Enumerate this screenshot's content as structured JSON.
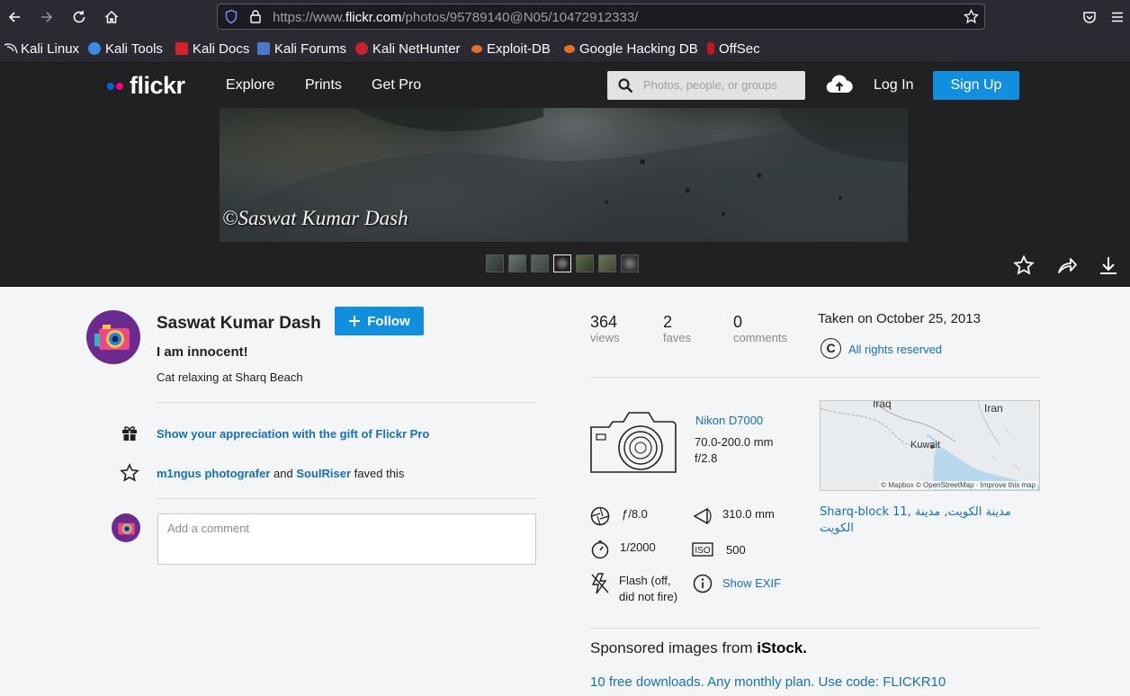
{
  "browser": {
    "url_prefix": "https://www.",
    "url_domain": "flickr.com",
    "url_path": "/photos/95789140@N05/10472912333/",
    "bookmarks": [
      {
        "label": "Kali Linux",
        "icon": "kali-dragon-icon"
      },
      {
        "label": "Kali Tools",
        "icon": "kali-tools-icon"
      },
      {
        "label": "Kali Docs",
        "icon": "kali-docs-icon"
      },
      {
        "label": "Kali Forums",
        "icon": "kali-forums-icon"
      },
      {
        "label": "Kali NetHunter",
        "icon": "nethunter-icon"
      },
      {
        "label": "Exploit-DB",
        "icon": "exploit-db-icon"
      },
      {
        "label": "Google Hacking DB",
        "icon": "ghdb-icon"
      },
      {
        "label": "OffSec",
        "icon": "offsec-icon"
      }
    ]
  },
  "header": {
    "logo_text": "flickr",
    "nav": [
      "Explore",
      "Prints",
      "Get Pro"
    ],
    "search_placeholder": "Photos, people, or groups",
    "login": "Log In",
    "signup": "Sign Up",
    "colors": {
      "brand_blue": "#128fdc",
      "dot_blue": "#0063dc",
      "dot_pink": "#ff0084"
    }
  },
  "photo": {
    "watermark": "©Saswat Kumar Dash"
  },
  "owner": {
    "name": "Saswat Kumar Dash",
    "follow_label": "Follow"
  },
  "details": {
    "title": "I am innocent!",
    "description": "Cat relaxing at Sharq Beach",
    "gift_link": "Show your appreciation with the gift of Flickr Pro",
    "fave_user_1": "m1ngus photografer",
    "fave_and": "and",
    "fave_user_2": "SoulRiser",
    "fave_suffix": "faved this",
    "comment_placeholder": "Add a comment"
  },
  "stats": {
    "views": {
      "value": "364",
      "label": "views"
    },
    "faves": {
      "value": "2",
      "label": "faves"
    },
    "comments": {
      "value": "0",
      "label": "comments"
    }
  },
  "meta": {
    "taken": "Taken on October 25, 2013",
    "rights": "All rights reserved"
  },
  "camera": {
    "name": "Nikon D7000",
    "lens": "70.0-200.0 mm",
    "aperture_max": "f/2.8"
  },
  "exif": {
    "aperture": "ƒ/8.0",
    "focal_length": "310.0 mm",
    "shutter": "1/2000",
    "iso": "500",
    "flash_1": "Flash (off,",
    "flash_2": "did not fire)",
    "show_exif": "Show EXIF"
  },
  "map": {
    "label_iraq": "Iraq",
    "label_iran": "Iran",
    "label_kuwait": "Kuwait",
    "attribution": "© Mapbox © OpenStreetMap · Improve this map"
  },
  "location": "Sharq-block 11, مدينة الكويت, مدينة الكويت",
  "sponsored": {
    "prefix": "Sponsored images from",
    "brand": "iStock.",
    "promo": "10 free downloads. Any monthly plan. Use code: FLICKR10"
  }
}
